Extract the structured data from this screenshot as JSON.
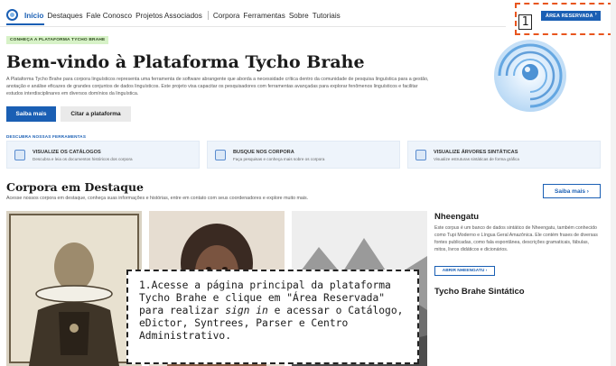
{
  "nav": {
    "items": [
      {
        "label": "Início",
        "active": true
      },
      {
        "label": "Destaques"
      },
      {
        "label": "Fale Conosco"
      },
      {
        "label": "Projetos Associados"
      },
      {
        "label": "Corpora"
      },
      {
        "label": "Ferramentas"
      },
      {
        "label": "Sobre"
      },
      {
        "label": "Tutoriais"
      }
    ],
    "area_button": "ÁREA RESERVADA",
    "area_button_icon": "arrow-right-icon"
  },
  "callout": {
    "number": "1"
  },
  "hero": {
    "badge": "CONHEÇA A PLATAFORMA TYCHO BRAHE",
    "title": "Bem-vindo à Plataforma Tycho Brahe",
    "description": "A Plataforma Tycho Brahe para corpora linguísticos representa uma ferramenta de software abrangente que aborda a necessidade crítica dentro da comunidade de pesquisa linguística para a gestão, anotação e análise eficazes de grandes conjuntos de dados linguísticos. Este projeto visa capacitar os pesquisadores com ferramentas avançadas para explorar fenômenos linguísticos e facilitar estudos interdisciplinares em diversos domínios da linguística.",
    "primary_button": "Saiba mais",
    "secondary_button": "Citar a plataforma"
  },
  "tools": {
    "label": "DESCUBRA NOSSAS FERRAMENTAS",
    "items": [
      {
        "title": "VISUALIZE OS CATÁLOGOS",
        "desc": "Descubra e leia os documentos históricos dos corpora",
        "icon": "document-icon"
      },
      {
        "title": "BUSQUE NOS CORPORA",
        "desc": "Faça pesquisas e conheça mais sobre os corpora",
        "icon": "search-corpus-icon"
      },
      {
        "title": "VISUALIZE ÁRVORES SINTÁTICAS",
        "desc": "Visualize estruturas sintáticas de forma gráfica",
        "icon": "tree-icon"
      }
    ]
  },
  "corpora": {
    "title": "Corpora em Destaque",
    "description": "Acesse nossos corpora em destaque, conheça suas informações e histórias, entre em contato com seus coordenadores e explore muito mais.",
    "more_button": "Saiba mais",
    "featured": {
      "title": "Nheengatu",
      "description": "Este corpus é um banco de dados sintático de Nheengatu, também conhecido como Tupi Moderno e Língua Geral Amazônica. Ele contém frases de diversas fontes publicadas, como fala espontânea, descrições gramaticais, fábulas, mitos, livros didáticos e dicionários.",
      "button": "ABRIR NHEENGATU"
    },
    "next_title": "Tycho Brahe Sintático"
  },
  "instruction": {
    "part1": "1.Acesse a página principal da plataforma Tycho Brahe e clique em \"Área Reservada\" para realizar ",
    "em1": "sign in",
    "part2": " e acessar o Catálogo, eDictor, Syntrees, Parser e Centro Administrativo."
  },
  "colors": {
    "accent": "#1a5fb4",
    "callout": "#e8551e",
    "badge_bg": "#d7f2c7"
  }
}
